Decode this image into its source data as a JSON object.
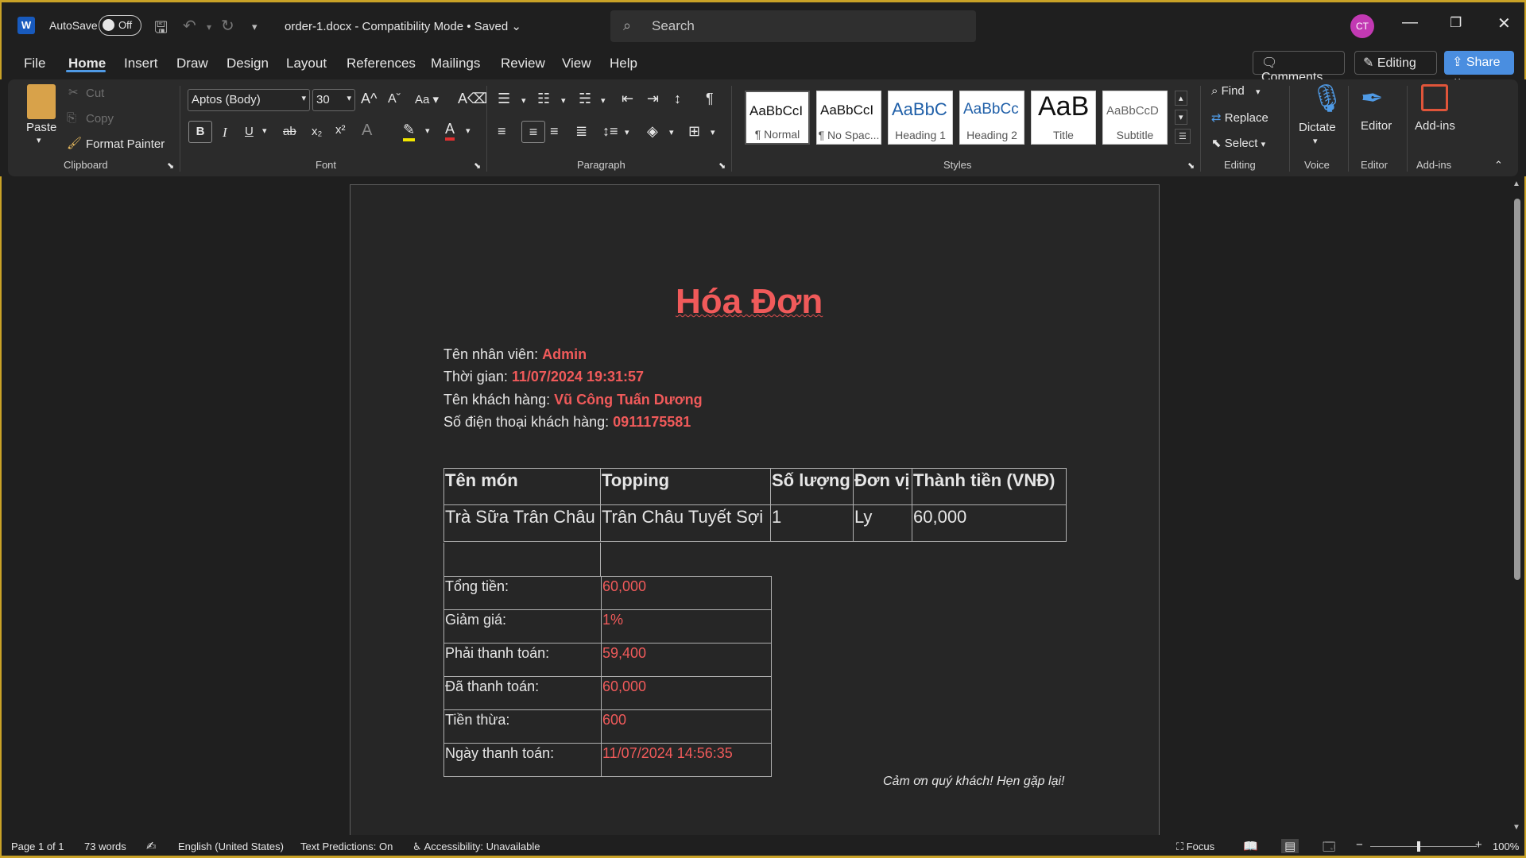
{
  "titlebar": {
    "app_icon": "word-icon",
    "autosave_label": "AutoSave",
    "autosave_state": "Off",
    "document_title": "order-1.docx  -  Compatibility Mode • Saved",
    "search_placeholder": "Search",
    "avatar_initials": "CT"
  },
  "menu": {
    "tabs": [
      "File",
      "Home",
      "Insert",
      "Draw",
      "Design",
      "Layout",
      "References",
      "Mailings",
      "Review",
      "View",
      "Help"
    ],
    "active_tab": "Home",
    "comments_label": "Comments",
    "editing_label": "Editing",
    "share_label": "Share"
  },
  "ribbon": {
    "clipboard": {
      "paste": "Paste",
      "cut": "Cut",
      "copy": "Copy",
      "format_painter": "Format Painter",
      "group": "Clipboard"
    },
    "font": {
      "name": "Aptos (Body)",
      "size": "30",
      "change_case": "Aa",
      "group": "Font"
    },
    "paragraph": {
      "group": "Paragraph"
    },
    "styles": {
      "items": [
        {
          "sample": "AaBbCcI",
          "name": "¶ Normal"
        },
        {
          "sample": "AaBbCcI",
          "name": "¶ No Spac..."
        },
        {
          "sample": "AaBbC",
          "name": "Heading 1"
        },
        {
          "sample": "AaBbCc",
          "name": "Heading 2"
        },
        {
          "sample": "AaB",
          "name": "Title"
        },
        {
          "sample": "AaBbCcD",
          "name": "Subtitle"
        }
      ],
      "group": "Styles"
    },
    "editing": {
      "find": "Find",
      "replace": "Replace",
      "select": "Select",
      "group": "Editing"
    },
    "voice": {
      "dictate": "Dictate",
      "group": "Voice"
    },
    "editor": {
      "label": "Editor",
      "group": "Editor"
    },
    "addins": {
      "label": "Add-ins",
      "group": "Add-ins"
    }
  },
  "document": {
    "heading": "Hóa Đơn",
    "info": [
      {
        "label": "Tên nhân viên: ",
        "value": "Admin"
      },
      {
        "label": "Thời gian: ",
        "value": "11/07/2024 19:31:57"
      },
      {
        "label": "Tên khách hàng: ",
        "value": "Vũ Công Tuấn Dương"
      },
      {
        "label": "Số điện thoại khách hàng: ",
        "value": "0911175581"
      }
    ],
    "items_table": {
      "headers": [
        "Tên món",
        "Topping",
        "Số lượng",
        "Đơn vị",
        "Thành tiền (VNĐ)"
      ],
      "rows": [
        [
          "Trà Sữa Trân Châu",
          "Trân Châu Tuyết Sợi",
          "1",
          "Ly",
          "60,000"
        ]
      ]
    },
    "totals": [
      {
        "label": "Tổng tiền:",
        "value": "60,000"
      },
      {
        "label": "Giảm giá:",
        "value": "1%"
      },
      {
        "label": "Phải thanh toán:",
        "value": "59,400"
      },
      {
        "label": "Đã thanh toán:",
        "value": "60,000"
      },
      {
        "label": "Tiền thừa:",
        "value": "600"
      },
      {
        "label": "Ngày thanh toán:",
        "value": "11/07/2024 14:56:35"
      }
    ],
    "footer": "Cảm ơn quý khách! Hẹn gặp lại!"
  },
  "status": {
    "page": "Page 1 of 1",
    "words": "73 words",
    "language": "English (United States)",
    "predictions": "Text Predictions: On",
    "accessibility": "Accessibility: Unavailable",
    "focus": "Focus",
    "zoom": "100%"
  },
  "colors": {
    "accent": "#4a8ee0",
    "highlight_text": "#f05a5a",
    "avatar": "#c239b3"
  }
}
